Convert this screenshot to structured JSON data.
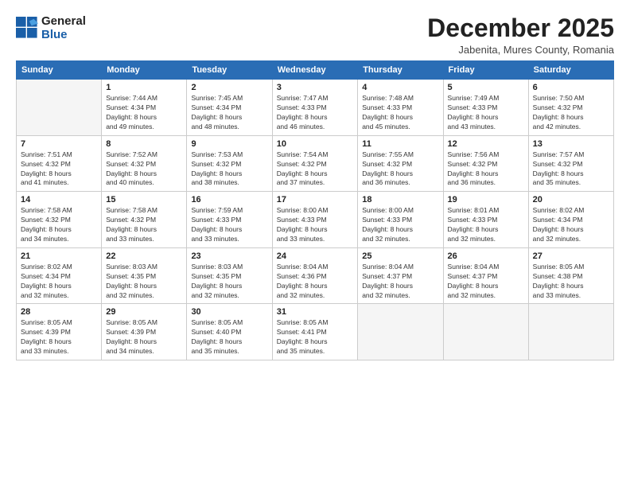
{
  "logo": {
    "line1": "General",
    "line2": "Blue"
  },
  "title": "December 2025",
  "subtitle": "Jabenita, Mures County, Romania",
  "weekdays": [
    "Sunday",
    "Monday",
    "Tuesday",
    "Wednesday",
    "Thursday",
    "Friday",
    "Saturday"
  ],
  "weeks": [
    [
      {
        "day": "",
        "sunrise": "",
        "sunset": "",
        "daylight": ""
      },
      {
        "day": "1",
        "sunrise": "Sunrise: 7:44 AM",
        "sunset": "Sunset: 4:34 PM",
        "daylight": "Daylight: 8 hours and 49 minutes."
      },
      {
        "day": "2",
        "sunrise": "Sunrise: 7:45 AM",
        "sunset": "Sunset: 4:34 PM",
        "daylight": "Daylight: 8 hours and 48 minutes."
      },
      {
        "day": "3",
        "sunrise": "Sunrise: 7:47 AM",
        "sunset": "Sunset: 4:33 PM",
        "daylight": "Daylight: 8 hours and 46 minutes."
      },
      {
        "day": "4",
        "sunrise": "Sunrise: 7:48 AM",
        "sunset": "Sunset: 4:33 PM",
        "daylight": "Daylight: 8 hours and 45 minutes."
      },
      {
        "day": "5",
        "sunrise": "Sunrise: 7:49 AM",
        "sunset": "Sunset: 4:33 PM",
        "daylight": "Daylight: 8 hours and 43 minutes."
      },
      {
        "day": "6",
        "sunrise": "Sunrise: 7:50 AM",
        "sunset": "Sunset: 4:32 PM",
        "daylight": "Daylight: 8 hours and 42 minutes."
      }
    ],
    [
      {
        "day": "7",
        "sunrise": "Sunrise: 7:51 AM",
        "sunset": "Sunset: 4:32 PM",
        "daylight": "Daylight: 8 hours and 41 minutes."
      },
      {
        "day": "8",
        "sunrise": "Sunrise: 7:52 AM",
        "sunset": "Sunset: 4:32 PM",
        "daylight": "Daylight: 8 hours and 40 minutes."
      },
      {
        "day": "9",
        "sunrise": "Sunrise: 7:53 AM",
        "sunset": "Sunset: 4:32 PM",
        "daylight": "Daylight: 8 hours and 38 minutes."
      },
      {
        "day": "10",
        "sunrise": "Sunrise: 7:54 AM",
        "sunset": "Sunset: 4:32 PM",
        "daylight": "Daylight: 8 hours and 37 minutes."
      },
      {
        "day": "11",
        "sunrise": "Sunrise: 7:55 AM",
        "sunset": "Sunset: 4:32 PM",
        "daylight": "Daylight: 8 hours and 36 minutes."
      },
      {
        "day": "12",
        "sunrise": "Sunrise: 7:56 AM",
        "sunset": "Sunset: 4:32 PM",
        "daylight": "Daylight: 8 hours and 36 minutes."
      },
      {
        "day": "13",
        "sunrise": "Sunrise: 7:57 AM",
        "sunset": "Sunset: 4:32 PM",
        "daylight": "Daylight: 8 hours and 35 minutes."
      }
    ],
    [
      {
        "day": "14",
        "sunrise": "Sunrise: 7:58 AM",
        "sunset": "Sunset: 4:32 PM",
        "daylight": "Daylight: 8 hours and 34 minutes."
      },
      {
        "day": "15",
        "sunrise": "Sunrise: 7:58 AM",
        "sunset": "Sunset: 4:32 PM",
        "daylight": "Daylight: 8 hours and 33 minutes."
      },
      {
        "day": "16",
        "sunrise": "Sunrise: 7:59 AM",
        "sunset": "Sunset: 4:33 PM",
        "daylight": "Daylight: 8 hours and 33 minutes."
      },
      {
        "day": "17",
        "sunrise": "Sunrise: 8:00 AM",
        "sunset": "Sunset: 4:33 PM",
        "daylight": "Daylight: 8 hours and 33 minutes."
      },
      {
        "day": "18",
        "sunrise": "Sunrise: 8:00 AM",
        "sunset": "Sunset: 4:33 PM",
        "daylight": "Daylight: 8 hours and 32 minutes."
      },
      {
        "day": "19",
        "sunrise": "Sunrise: 8:01 AM",
        "sunset": "Sunset: 4:33 PM",
        "daylight": "Daylight: 8 hours and 32 minutes."
      },
      {
        "day": "20",
        "sunrise": "Sunrise: 8:02 AM",
        "sunset": "Sunset: 4:34 PM",
        "daylight": "Daylight: 8 hours and 32 minutes."
      }
    ],
    [
      {
        "day": "21",
        "sunrise": "Sunrise: 8:02 AM",
        "sunset": "Sunset: 4:34 PM",
        "daylight": "Daylight: 8 hours and 32 minutes."
      },
      {
        "day": "22",
        "sunrise": "Sunrise: 8:03 AM",
        "sunset": "Sunset: 4:35 PM",
        "daylight": "Daylight: 8 hours and 32 minutes."
      },
      {
        "day": "23",
        "sunrise": "Sunrise: 8:03 AM",
        "sunset": "Sunset: 4:35 PM",
        "daylight": "Daylight: 8 hours and 32 minutes."
      },
      {
        "day": "24",
        "sunrise": "Sunrise: 8:04 AM",
        "sunset": "Sunset: 4:36 PM",
        "daylight": "Daylight: 8 hours and 32 minutes."
      },
      {
        "day": "25",
        "sunrise": "Sunrise: 8:04 AM",
        "sunset": "Sunset: 4:37 PM",
        "daylight": "Daylight: 8 hours and 32 minutes."
      },
      {
        "day": "26",
        "sunrise": "Sunrise: 8:04 AM",
        "sunset": "Sunset: 4:37 PM",
        "daylight": "Daylight: 8 hours and 32 minutes."
      },
      {
        "day": "27",
        "sunrise": "Sunrise: 8:05 AM",
        "sunset": "Sunset: 4:38 PM",
        "daylight": "Daylight: 8 hours and 33 minutes."
      }
    ],
    [
      {
        "day": "28",
        "sunrise": "Sunrise: 8:05 AM",
        "sunset": "Sunset: 4:39 PM",
        "daylight": "Daylight: 8 hours and 33 minutes."
      },
      {
        "day": "29",
        "sunrise": "Sunrise: 8:05 AM",
        "sunset": "Sunset: 4:39 PM",
        "daylight": "Daylight: 8 hours and 34 minutes."
      },
      {
        "day": "30",
        "sunrise": "Sunrise: 8:05 AM",
        "sunset": "Sunset: 4:40 PM",
        "daylight": "Daylight: 8 hours and 35 minutes."
      },
      {
        "day": "31",
        "sunrise": "Sunrise: 8:05 AM",
        "sunset": "Sunset: 4:41 PM",
        "daylight": "Daylight: 8 hours and 35 minutes."
      },
      {
        "day": "",
        "sunrise": "",
        "sunset": "",
        "daylight": ""
      },
      {
        "day": "",
        "sunrise": "",
        "sunset": "",
        "daylight": ""
      },
      {
        "day": "",
        "sunrise": "",
        "sunset": "",
        "daylight": ""
      }
    ]
  ]
}
